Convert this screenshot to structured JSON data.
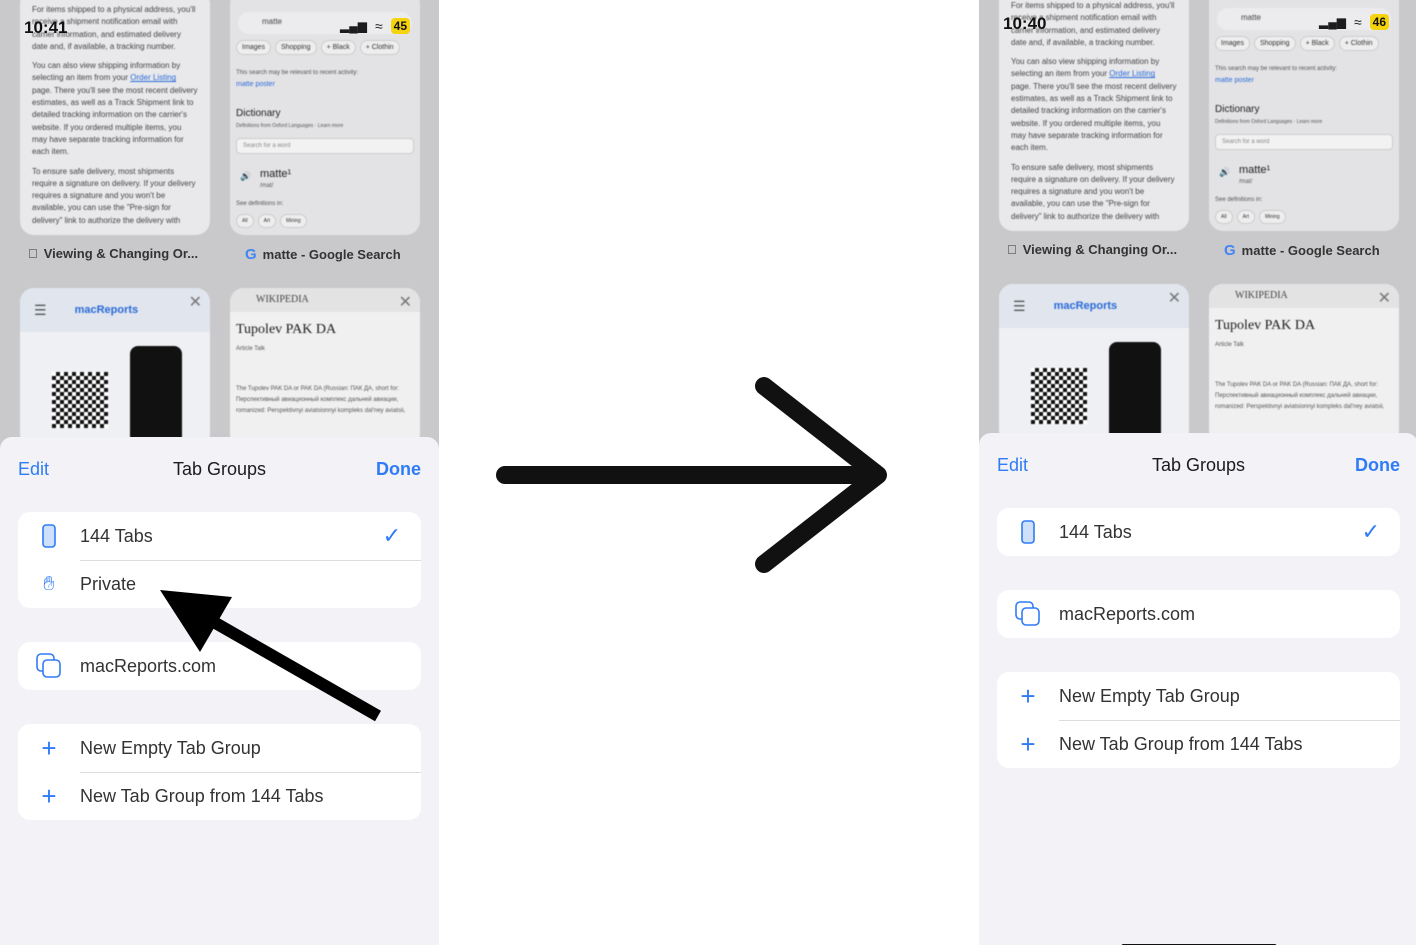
{
  "arrow_icon": "arrow-right-icon",
  "accent": "#2f7cf6",
  "left": {
    "status": {
      "time": "10:41",
      "battery": "45"
    },
    "thumbs": {
      "apple_text": [
        "For items shipped to a physical address, you'll receive a shipment notification email with carrier information, and estimated delivery date and, if available, a tracking number.",
        "You can also view shipping information by selecting an item from your",
        "page. There you'll see the most recent delivery estimates, as well as a Track Shipment link to detailed tracking information on the carrier's website. If you ordered multiple items, you may have separate tracking information for each item.",
        "To ensure safe delivery, most shipments require a signature on delivery. If your delivery requires a signature and you won't be available, you can use the \"Pre-sign for delivery\" link to authorize the delivery with"
      ],
      "order_link": "Order Listing",
      "apple_label": "Viewing & Changing Or...",
      "google_query": "matte",
      "chips": [
        "Images",
        "Shopping",
        "+ Black",
        "+ Clothin"
      ],
      "recent_note": "This search may be relevant to recent activity:",
      "recent_link": "matte poster",
      "dictionary": "Dictionary",
      "dict_source": "Definitions from Oxford Languages · Learn more",
      "word_placeholder": "Search for a word",
      "word": "matte¹",
      "phon": "/mat/",
      "see_defs": "See definitions in:",
      "def_chips": [
        "All",
        "Art",
        "Mining"
      ],
      "google_label": "matte - Google Search",
      "macreports_logo": "macReports",
      "wiki_logo": "WIKIPEDIA",
      "wiki_title": "Tupolev PAK DA",
      "wiki_tabs": "Article   Talk",
      "wiki_text": "The Tupolev PAK DA or PAK DA (Russian: ПАК ДА, short for: Перспективный авиационный комплекс дальней авиации, romanized: Perspektivnyi aviatsionnyi kompleks dal'ney aviatsii,"
    },
    "sheet": {
      "edit": "Edit",
      "title": "Tab Groups",
      "done": "Done",
      "groups": [
        {
          "label": "144 Tabs",
          "icon": "iphone-icon",
          "selected": true
        },
        {
          "label": "Private",
          "icon": "hand-icon"
        }
      ],
      "shared": {
        "label": "macReports.com",
        "icon": "tab-group-icon"
      },
      "actions": [
        "New Empty Tab Group",
        "New Tab Group from 144 Tabs"
      ]
    }
  },
  "right": {
    "status": {
      "time": "10:40",
      "battery": "46"
    },
    "thumbs": {
      "apple_text": [
        "For items shipped to a physical address, you'll receive a shipment notification email with carrier information, and estimated delivery date and, if available, a tracking number.",
        "You can also view shipping information by selecting an item from your",
        "page. There you'll see the most recent delivery estimates, as well as a Track Shipment link to detailed tracking information on the carrier's website. If you ordered multiple items, you may have separate tracking information for each item.",
        "To ensure safe delivery, most shipments require a signature on delivery. If your delivery requires a signature and you won't be available, you can use the \"Pre-sign for delivery\" link to authorize the delivery with"
      ],
      "order_link": "Order Listing",
      "apple_label": "Viewing & Changing Or...",
      "google_query": "matte",
      "chips": [
        "Images",
        "Shopping",
        "+ Black",
        "+ Clothin"
      ],
      "recent_note": "This search may be relevant to recent activity:",
      "recent_link": "matte poster",
      "dictionary": "Dictionary",
      "dict_source": "Definitions from Oxford Languages · Learn more",
      "word_placeholder": "Search for a word",
      "word": "matte¹",
      "phon": "/mat/",
      "see_defs": "See definitions in:",
      "def_chips": [
        "All",
        "Art",
        "Mining"
      ],
      "google_label": "matte - Google Search",
      "macreports_logo": "macReports",
      "wiki_logo": "WIKIPEDIA",
      "wiki_title": "Tupolev PAK DA",
      "wiki_tabs": "Article   Talk",
      "wiki_text": "The Tupolev PAK DA or PAK DA (Russian: ПАК ДА, short for: Перспективный авиационный комплекс дальней авиации, romanized: Perspektivnyi aviatsionnyi kompleks dal'ney aviatsii,"
    },
    "sheet": {
      "edit": "Edit",
      "title": "Tab Groups",
      "done": "Done",
      "groups": [
        {
          "label": "144 Tabs",
          "icon": "iphone-icon",
          "selected": true
        }
      ],
      "shared": {
        "label": "macReports.com",
        "icon": "tab-group-icon"
      },
      "actions": [
        "New Empty Tab Group",
        "New Tab Group from 144 Tabs"
      ]
    }
  }
}
